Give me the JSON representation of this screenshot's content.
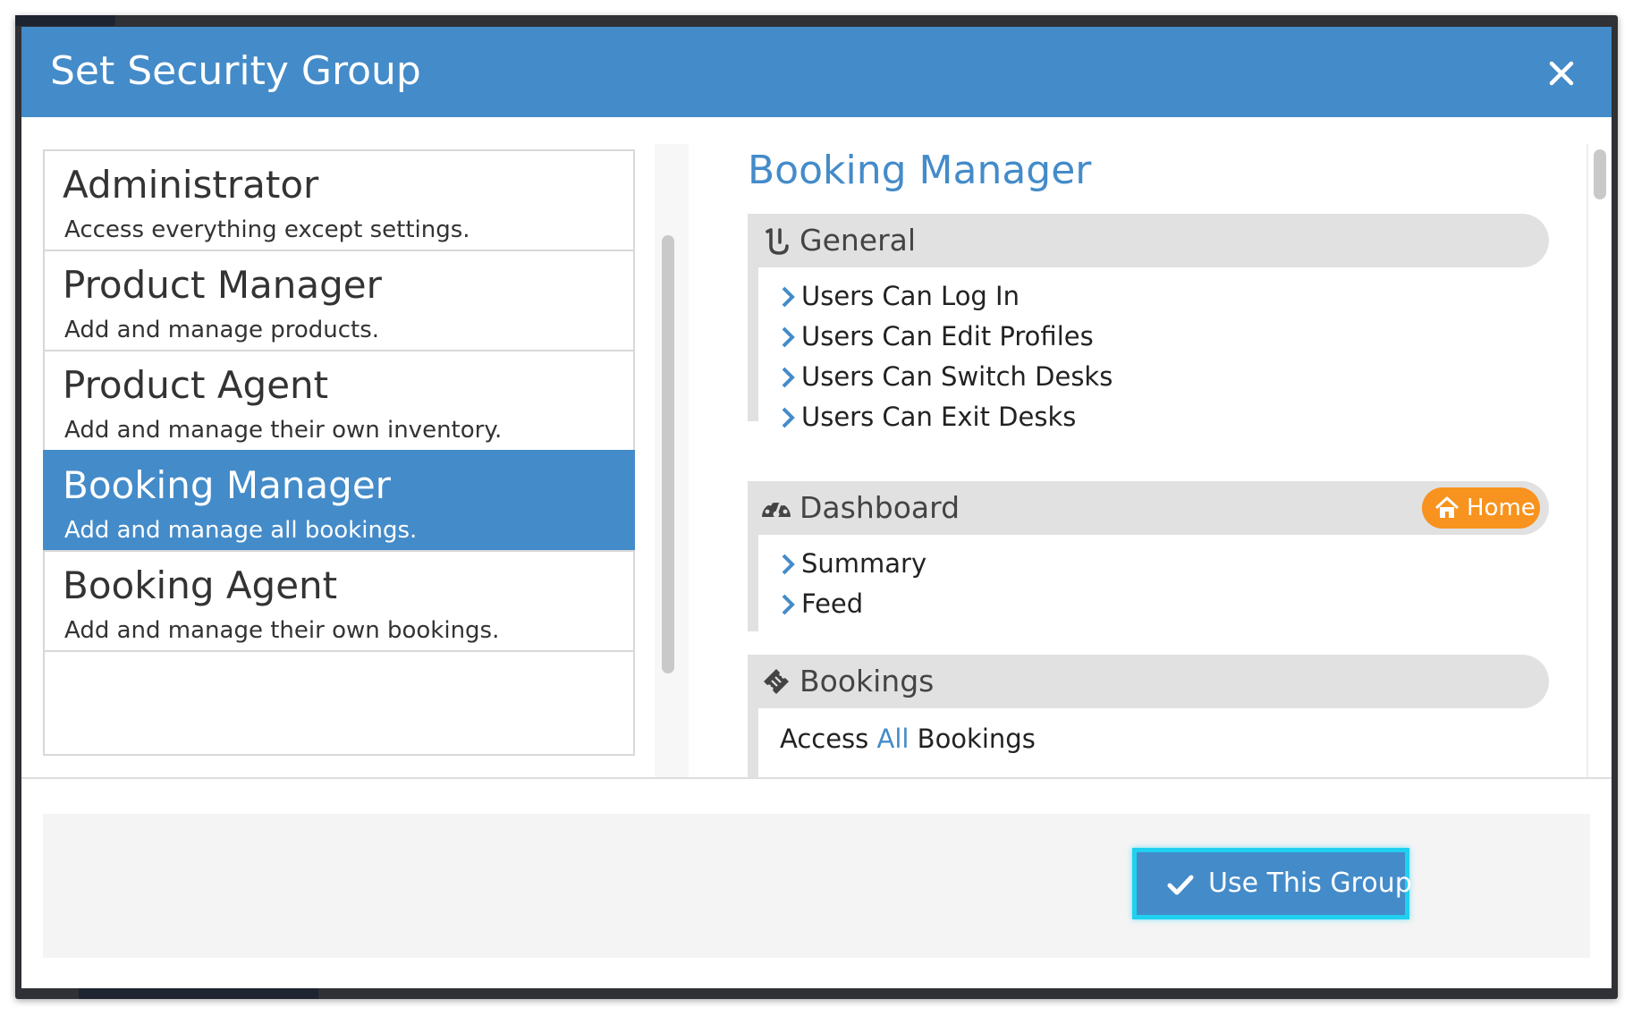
{
  "modal": {
    "title": "Set Security Group",
    "close_icon": "close-icon"
  },
  "groups": [
    {
      "name": "Administrator",
      "description": "Access everything except settings.",
      "selected": false
    },
    {
      "name": "Product Manager",
      "description": "Add and manage products.",
      "selected": false
    },
    {
      "name": "Product Agent",
      "description": "Add and manage their own inventory.",
      "selected": false
    },
    {
      "name": "Booking Manager",
      "description": "Add and manage all bookings.",
      "selected": true
    },
    {
      "name": "Booking Agent",
      "description": "Add and manage their own bookings.",
      "selected": false
    }
  ],
  "detail": {
    "title": "Booking Manager",
    "sections": [
      {
        "title": "General",
        "icon": "login-hook-icon",
        "permissions": [
          "Users Can Log In",
          "Users Can Edit Profiles",
          "Users Can Switch Desks",
          "Users Can Exit Desks"
        ]
      },
      {
        "title": "Dashboard",
        "icon": "dashboard-gauge-icon",
        "badge": {
          "label": "Home",
          "icon": "home-icon",
          "color": "#f7931e"
        },
        "permissions": [
          "Summary",
          "Feed"
        ]
      },
      {
        "title": "Bookings",
        "icon": "ticket-icon",
        "access_prefix": "Access ",
        "access_highlight": "All",
        "access_suffix": " Bookings"
      }
    ]
  },
  "footer": {
    "use_button_label": "Use This Group",
    "use_button_icon": "checkmark-icon"
  },
  "colors": {
    "primary": "#448bc9",
    "accent_focus": "#1fd0f0",
    "badge_orange": "#f7931e"
  }
}
